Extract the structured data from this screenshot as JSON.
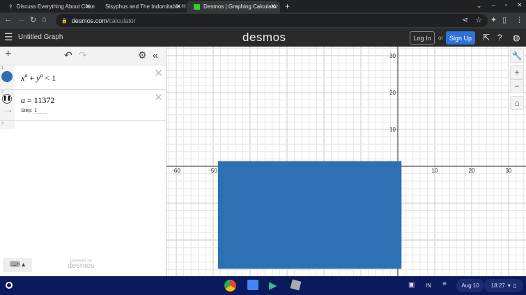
{
  "browser": {
    "tabs": [
      {
        "title": "Discuss Everything About Chang",
        "icon": "upload-icon"
      },
      {
        "title": "Sisyphus and The Indomitable H",
        "icon": "youtube-icon"
      },
      {
        "title": "Desmos | Graphing Calculator",
        "icon": "desmos-icon",
        "active": true
      }
    ],
    "url_domain": "desmos.com",
    "url_path": "/calculator"
  },
  "header": {
    "title": "Untitled Graph",
    "logo": "desmos",
    "login": "Log In",
    "or": "or",
    "signup": "Sign Up"
  },
  "expressions": [
    {
      "num": "1",
      "latex_parts": [
        "x",
        "a",
        "+",
        "y",
        "a",
        "< 1"
      ]
    },
    {
      "num": "2",
      "var": "a",
      "eq": "= 11372",
      "step_label": "Step:",
      "step_value": "1"
    },
    {
      "num": "3"
    }
  ],
  "powered": {
    "line1": "powered by",
    "line2": "desmos"
  },
  "graph": {
    "x_ticks": [
      "-60",
      "-50",
      "10",
      "20",
      "30"
    ],
    "y_ticks": [
      "10",
      "20",
      "30"
    ],
    "region_color": "#2d70b3",
    "region": {
      "xmin": -48.7,
      "xmax": 1,
      "ymin": -27.8,
      "ymax": 1.4
    }
  },
  "shelf": {
    "date": "Aug 10",
    "time": "18:27",
    "ime": "IN"
  }
}
